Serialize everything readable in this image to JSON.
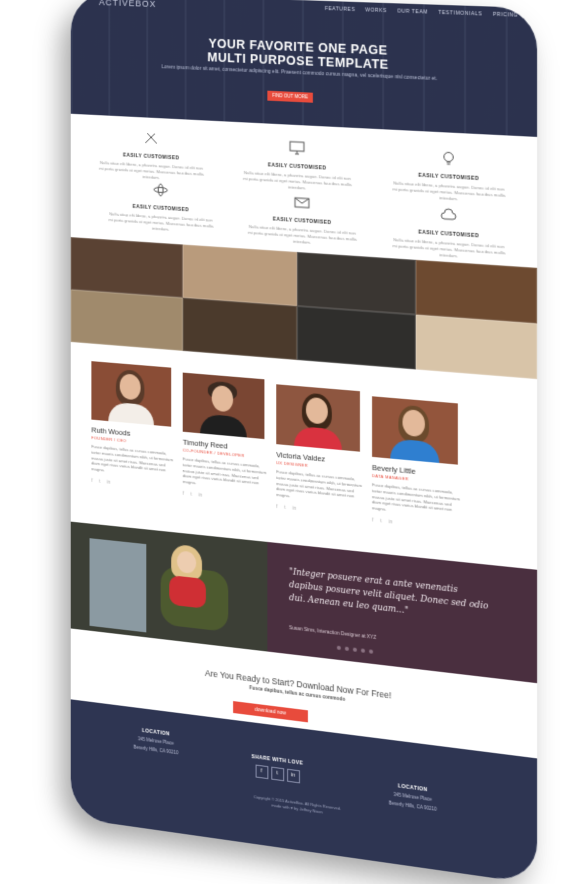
{
  "brand": {
    "logo": "ACTIVEBOX"
  },
  "nav": {
    "items": [
      "FEATURES",
      "WORKS",
      "OUR TEAM",
      "TESTIMONIALS",
      "PRICING"
    ]
  },
  "hero": {
    "title_line1": "YOUR FAVORITE ONE PAGE",
    "title_line2": "MULTI PURPOSE TEMPLATE",
    "subtitle": "Lorem ipsum dolor sit amet, consectetur adipiscing elit. Praesent commodo cursus magna, vel scelerisque nisl consectetur et.",
    "button": "FIND OUT MORE"
  },
  "features": [
    {
      "title": "EASILY CUSTOMISED",
      "icon": "pencil-ruler-icon",
      "text": "Nulla vitae elit libero, a pharetra augue. Donec id elit non mi porta gravida at eget metus. Maecenas faucibus mollis interdum."
    },
    {
      "title": "EASILY CUSTOMISED",
      "icon": "monitor-icon",
      "text": "Nulla vitae elit libero, a pharetra augue. Donec id elit non mi porta gravida at eget metus. Maecenas faucibus mollis interdum."
    },
    {
      "title": "EASILY CUSTOMISED",
      "icon": "lightbulb-icon",
      "text": "Nulla vitae elit libero, a pharetra augue. Donec id elit non mi porta gravida at eget metus. Maecenas faucibus mollis interdum."
    },
    {
      "title": "EASILY CUSTOMISED",
      "icon": "atom-icon",
      "text": "Nulla vitae elit libero, a pharetra augue. Donec id elit non mi porta gravida at eget metus. Maecenas faucibus mollis interdum."
    },
    {
      "title": "EASILY CUSTOMISED",
      "icon": "envelope-icon",
      "text": "Nulla vitae elit libero, a pharetra augue. Donec id elit non mi porta gravida at eget metus. Maecenas faucibus mollis interdum."
    },
    {
      "title": "EASILY CUSTOMISED",
      "icon": "cloud-icon",
      "text": "Nulla vitae elit libero, a pharetra augue. Donec id elit non mi porta gravida at eget metus. Maecenas faucibus mollis interdum."
    }
  ],
  "team": [
    {
      "name": "Ruth Woods",
      "role": "FOUNDER / CEO",
      "bio": "Fusce dapibus, tellus ac cursus commodo, tortor mauris condimentum nibh, ut fermentum massa justo sit amet risus. Maecenas sed diam eget risus varius blandit sit amet non magna."
    },
    {
      "name": "Timothy Reed",
      "role": "CO-FOUNDER / DEVELOPER",
      "bio": "Fusce dapibus, tellus ac cursus commodo, tortor mauris condimentum nibh, ut fermentum massa justo sit amet risus. Maecenas sed diam eget risus varius blandit sit amet non magna."
    },
    {
      "name": "Victoria Valdez",
      "role": "UX DESIGNER",
      "bio": "Fusce dapibus, tellus ac cursus commodo, tortor mauris condimentum nibh, ut fermentum massa justo sit amet risus. Maecenas sed diam eget risus varius blandit sit amet non magna."
    },
    {
      "name": "Beverly Little",
      "role": "DATA MANAGER",
      "bio": "Fusce dapibus, tellus ac cursus commodo, tortor mauris condimentum nibh, ut fermentum massa justo sit amet risus. Maecenas sed diam eget risus varius blandit sit amet non magna."
    }
  ],
  "team_social": {
    "facebook": "f",
    "twitter": "t",
    "linkedin": "in"
  },
  "testimonial": {
    "quote": "\"Integer posuere erat a ante venenatis dapibus posuere velit aliquet. Donec sed odio dui. Aenean eu leo quam...\"",
    "author": "Susan Sims, Interaction Designer at XYZ"
  },
  "cta": {
    "heading": "Are You Ready to Start? Download Now For Free!",
    "sub": "Fusce dapibus, tellus ac cursus commodo",
    "button": "download now"
  },
  "footer": {
    "location_title": "LOCATION",
    "location_line1": "345 Melrose Place",
    "location_line2": "Beverly Hills, CA 90210",
    "share_title": "SHARE WITH LOVE",
    "location2_title": "LOCATION",
    "location2_line1": "345 Melrose Place",
    "location2_line2": "Beverly Hills, CA 90210",
    "copyright": "Copyright © 2015 ActiveBox. All Rights Reserved.",
    "made_with": "made with ♥ by Jeffrey Nixon"
  },
  "colors": {
    "navy": "#2e3552",
    "accent": "#e84b3c",
    "plum": "#4a2f3f"
  }
}
